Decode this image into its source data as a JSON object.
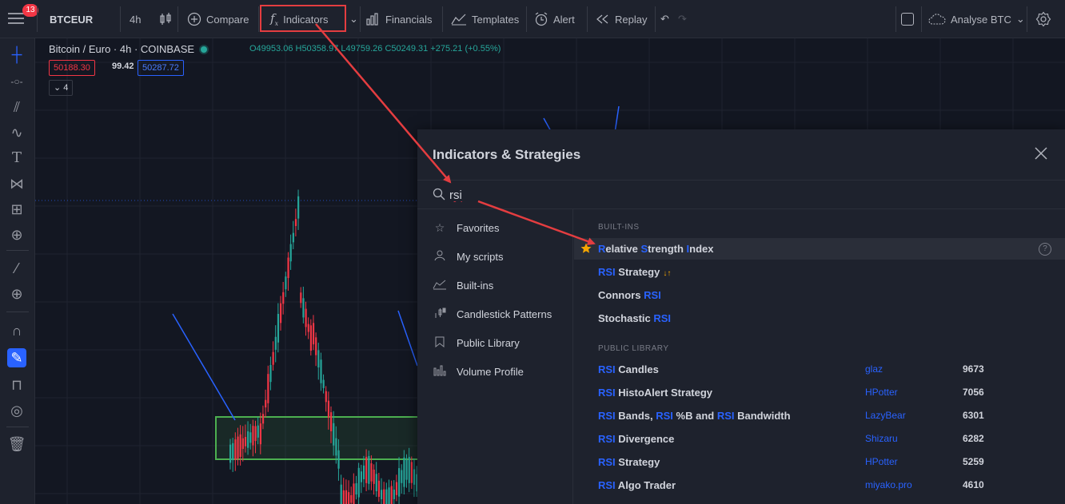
{
  "toolbar": {
    "badge": "13",
    "symbol": "BTCEUR",
    "interval": "4h",
    "compare": "Compare",
    "indicators": "Indicators",
    "financials": "Financials",
    "templates": "Templates",
    "alert": "Alert",
    "replay": "Replay",
    "layout": "Analyse BTC"
  },
  "legend": {
    "title": "Bitcoin / Euro · 4h · COINBASE",
    "o": "O49953.06",
    "h": "H50358.97",
    "l": "L49759.26",
    "c": "C50249.31",
    "change": "+275.21 (+0.55%)",
    "sell": "50188.30",
    "spread": "99.42",
    "buy": "50287.72",
    "collapsed_count": "4"
  },
  "dialog": {
    "title": "Indicators & Strategies",
    "search_value": "rsi",
    "sidebar": [
      {
        "label": "Favorites",
        "icon": "star-outline-icon"
      },
      {
        "label": "My scripts",
        "icon": "user-icon"
      },
      {
        "label": "Built-ins",
        "icon": "builtins-chart-icon"
      },
      {
        "label": "Candlestick Patterns",
        "icon": "candles-icon"
      },
      {
        "label": "Public Library",
        "icon": "bookmark-icon"
      },
      {
        "label": "Volume Profile",
        "icon": "volume-profile-icon"
      }
    ],
    "builtins_header": "BUILT-INS",
    "builtins": [
      {
        "label": "Relative Strength Index"
      },
      {
        "label": "RSI Strategy"
      },
      {
        "label": "Connors RSI"
      },
      {
        "label": "Stochastic RSI"
      }
    ],
    "public_header": "PUBLIC LIBRARY",
    "public": [
      {
        "label": "RSI Candles",
        "author": "glaz",
        "count": "9673"
      },
      {
        "label": "RSI HistoAlert Strategy",
        "author": "HPotter",
        "count": "7056"
      },
      {
        "label": "RSI Bands, RSI %B and RSI Bandwidth",
        "author": "LazyBear",
        "count": "6301"
      },
      {
        "label": "RSI Divergence",
        "author": "Shizaru",
        "count": "6282"
      },
      {
        "label": "RSI Strategy",
        "author": "HPotter",
        "count": "5259"
      },
      {
        "label": "RSI Algo Trader",
        "author": "miyako.pro",
        "count": "4610"
      }
    ]
  },
  "colors": {
    "accent": "#2962ff",
    "up": "#26a69a",
    "down": "#f23645",
    "annotation": "#e43d40",
    "zone": "#4caf50"
  }
}
